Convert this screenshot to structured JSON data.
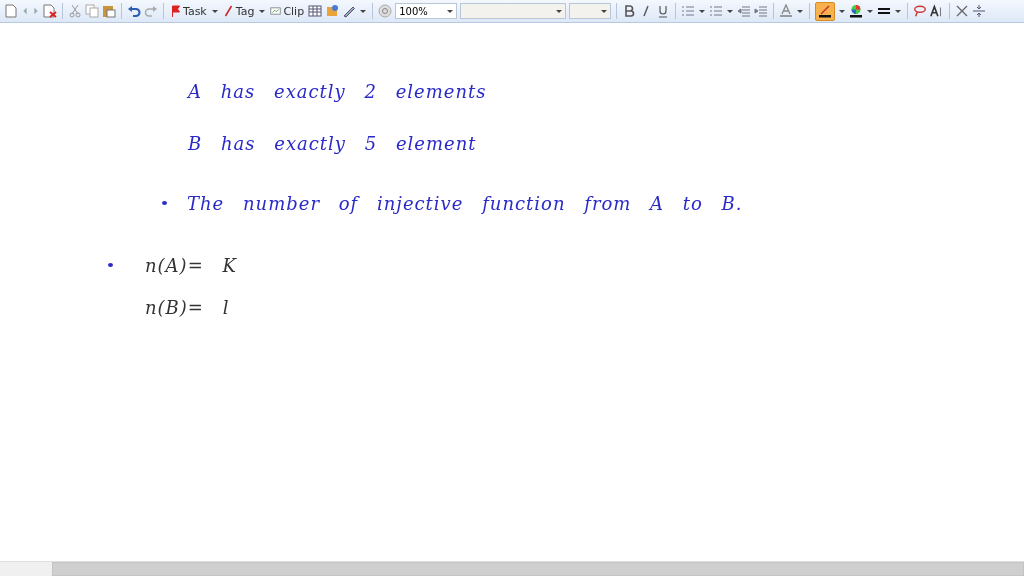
{
  "toolbar": {
    "task_label": "Task",
    "tag_label": "Tag",
    "clip_label": "Clip",
    "zoom": "100%",
    "pen_selected": true
  },
  "note": {
    "blocks": [
      {
        "bullet": false,
        "lines": [
          {
            "text": "A has exactly 2 elements",
            "color": "#2a2ac8"
          },
          {
            "text": "B has exactly 5 element",
            "color": "#2a2ac8"
          }
        ]
      },
      {
        "bullet": true,
        "lines": [
          {
            "text": "The number of injective function from A to B.",
            "color": "#2a2ac8"
          }
        ]
      },
      {
        "bullet": true,
        "lines": [
          {
            "text": "n(A)= K",
            "color": "#333333"
          },
          {
            "text": "n(B)= l",
            "color": "#333333"
          }
        ]
      }
    ]
  }
}
